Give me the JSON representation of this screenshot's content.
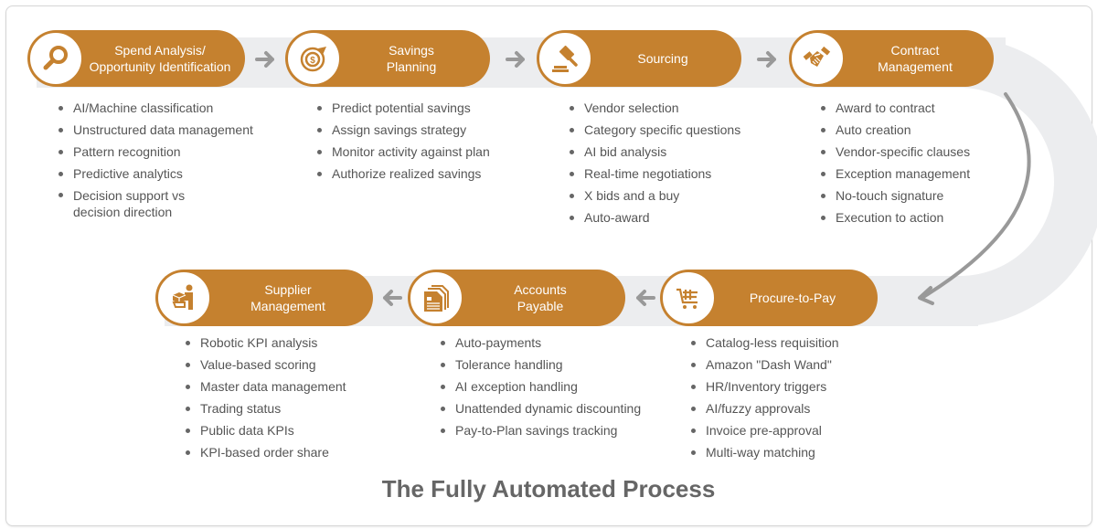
{
  "colors": {
    "accent": "#c5812f",
    "band": "#ecedef",
    "arrow": "#999999",
    "text": "#555555",
    "title": "#666666"
  },
  "title": "The Fully Automated Process",
  "steps": [
    {
      "label": "Spend Analysis/\nOpportunity Identification",
      "icon": "magnifying-glass-icon",
      "bullets": [
        "AI/Machine classification",
        "Unstructured data management",
        "Pattern recognition",
        "Predictive analytics",
        "Decision support vs decision direction"
      ]
    },
    {
      "label": "Savings\nPlanning",
      "icon": "target-dollar-icon",
      "bullets": [
        "Predict potential savings",
        "Assign savings strategy",
        "Monitor activity against plan",
        "Authorize realized savings"
      ]
    },
    {
      "label": "Sourcing",
      "icon": "gavel-icon",
      "bullets": [
        "Vendor selection",
        "Category specific questions",
        "AI bid analysis",
        "Real-time negotiations",
        "X bids and a buy",
        "Auto-award"
      ]
    },
    {
      "label": "Contract\nManagement",
      "icon": "handshake-icon",
      "bullets": [
        "Award to contract",
        "Auto creation",
        "Vendor-specific clauses",
        "Exception management",
        "No-touch signature",
        "Execution to action"
      ]
    },
    {
      "label": "Procure-to-Pay",
      "icon": "shopping-cart-icon",
      "bullets": [
        "Catalog-less requisition",
        "Amazon \"Dash Wand\"",
        "HR/Inventory triggers",
        "AI/fuzzy approvals",
        "Invoice pre-approval",
        "Multi-way matching"
      ]
    },
    {
      "label": "Accounts\nPayable",
      "icon": "documents-icon",
      "bullets": [
        "Auto-payments",
        "Tolerance handling",
        "AI exception handling",
        "Unattended dynamic discounting",
        "Pay-to-Plan savings tracking"
      ]
    },
    {
      "label": "Supplier\nManagement",
      "icon": "person-with-box-icon",
      "bullets": [
        "Robotic KPI analysis",
        "Value-based scoring",
        "Master data management",
        "Trading status",
        "Public data KPIs",
        "KPI-based order share"
      ]
    }
  ]
}
